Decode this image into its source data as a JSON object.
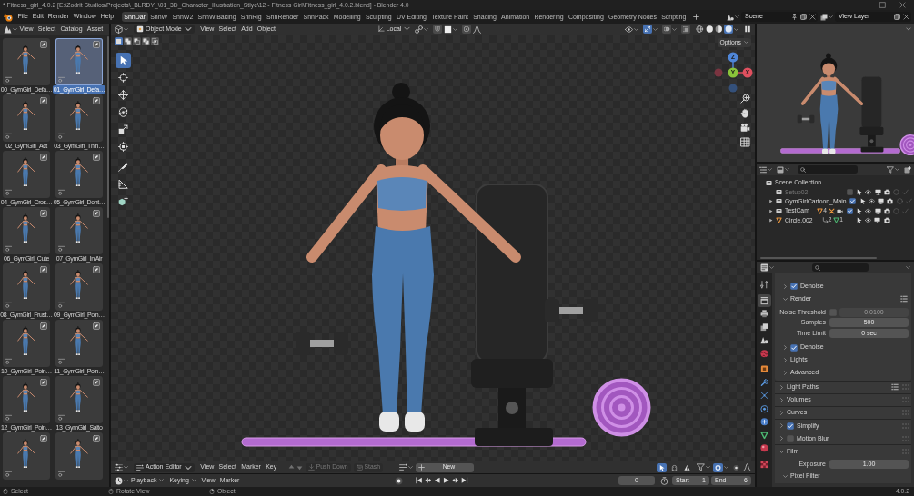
{
  "window": {
    "title": "* Fitness_girl_4.0.2 [E:\\Zodrit Studios\\Projects\\_BLRDY_\\01_3D_Character_Illustration_Stlye\\12 - Fitness Girl\\Fitness_girl_4.0.2.blend] - Blender 4.0"
  },
  "menu_bar": {
    "menus": [
      "File",
      "Edit",
      "Render",
      "Window",
      "Help"
    ],
    "workspaces": [
      {
        "label": "ShnDar",
        "selected": true
      },
      {
        "label": "ShnW",
        "selected": false
      },
      {
        "label": "ShnW2",
        "selected": false
      },
      {
        "label": "ShnW.Baking",
        "selected": false
      },
      {
        "label": "ShnRig",
        "selected": false
      },
      {
        "label": "ShnRender",
        "selected": false
      },
      {
        "label": "ShnPack",
        "selected": false
      },
      {
        "label": "Modelling",
        "selected": false
      },
      {
        "label": "Sculpting",
        "selected": false
      },
      {
        "label": "UV Editing",
        "selected": false
      },
      {
        "label": "Texture Paint",
        "selected": false
      },
      {
        "label": "Shading",
        "selected": false
      },
      {
        "label": "Animation",
        "selected": false
      },
      {
        "label": "Rendering",
        "selected": false
      },
      {
        "label": "Compositing",
        "selected": false
      },
      {
        "label": "Geometry Nodes",
        "selected": false
      },
      {
        "label": "Scripting",
        "selected": false
      }
    ],
    "scene": "Scene",
    "view_layer": "View Layer"
  },
  "asset_browser": {
    "menus": [
      "View",
      "Select",
      "Catalog",
      "Asset"
    ],
    "assets": [
      {
        "label": "00_GymGirl_Defa…",
        "selected": false
      },
      {
        "label": "01_GymGirl_Defa…",
        "selected": true
      },
      {
        "label": "02_GymGirl_Act",
        "selected": false
      },
      {
        "label": "03_GymGirl_Thin…",
        "selected": false
      },
      {
        "label": "04_GymGirl_Cros…",
        "selected": false
      },
      {
        "label": "05_GymGirl_Dont…",
        "selected": false
      },
      {
        "label": "06_GymGirl_Cute",
        "selected": false
      },
      {
        "label": "07_GymGirl_In Air",
        "selected": false
      },
      {
        "label": "08_GymGirl_Frust…",
        "selected": false
      },
      {
        "label": "09_GymGirl_Poin…",
        "selected": false
      },
      {
        "label": "10_GymGirl_Poin…",
        "selected": false
      },
      {
        "label": "11_GymGirl_Poin…",
        "selected": false
      },
      {
        "label": "12_GymGirl_Poin…",
        "selected": false
      },
      {
        "label": "13_GymGirl_Salto",
        "selected": false
      },
      {
        "selected": false
      },
      {
        "selected": false
      }
    ]
  },
  "viewport": {
    "mode": "Object Mode",
    "menus": [
      "View",
      "Select",
      "Add",
      "Object"
    ],
    "orientation": "Local",
    "toggles": [
      {
        "kind": "snap",
        "on": false
      },
      {
        "kind": "proportional",
        "on": false
      },
      {
        "kind": "gizmos",
        "on": true
      },
      {
        "kind": "overlays",
        "on": false
      },
      {
        "kind": "xray",
        "on": false
      }
    ],
    "shading": [
      {
        "kind": "wireframe",
        "selected": false
      },
      {
        "kind": "solid",
        "selected": false
      },
      {
        "kind": "material",
        "selected": false
      },
      {
        "kind": "rendered",
        "selected": true
      }
    ],
    "select_modes": [
      {
        "kind": "set",
        "selected": true
      },
      {
        "kind": "extend",
        "selected": false
      },
      {
        "kind": "subtract",
        "selected": false
      },
      {
        "kind": "difference",
        "selected": false
      },
      {
        "kind": "intersect",
        "selected": false
      }
    ],
    "options": "Options",
    "tools": [
      {
        "kind": "select_box",
        "selected": true
      },
      {
        "kind": "cursor",
        "selected": false
      },
      {
        "kind": "move",
        "selected": false
      },
      {
        "kind": "rotate",
        "selected": false
      },
      {
        "kind": "scale",
        "selected": false
      },
      {
        "kind": "transform",
        "selected": false
      },
      {
        "kind": "annotate",
        "selected": false
      },
      {
        "kind": "measure",
        "selected": false
      },
      {
        "kind": "add_cube",
        "selected": false
      }
    ],
    "gizmo_axes": [
      "Z",
      "Y",
      "X"
    ]
  },
  "outliner": {
    "root": "Scene Collection",
    "items": [
      {
        "kind": "collection",
        "label": "Setup02",
        "checked": false
      },
      {
        "kind": "collection",
        "label": "GymGirlCartoon_Main",
        "expanded": false,
        "checked": true
      },
      {
        "kind": "collection",
        "label": "TestCam",
        "expanded": false,
        "checked": true,
        "contents": [
          {
            "kind": "mesh",
            "count": "4"
          },
          {
            "kind": "armature"
          },
          {
            "kind": "camera"
          }
        ]
      },
      {
        "kind": "object",
        "label": "Circle.002",
        "expanded": false,
        "contents": [
          {
            "kind": "child",
            "count": "2"
          },
          {
            "kind": "mesh_data",
            "count": "1"
          }
        ]
      }
    ]
  },
  "properties": {
    "tabs": [
      {
        "kind": "tool",
        "selected": false
      },
      {
        "kind": "render",
        "selected": true
      },
      {
        "kind": "output",
        "selected": false
      },
      {
        "kind": "view_layer",
        "selected": false
      },
      {
        "kind": "scene",
        "selected": false
      },
      {
        "kind": "world",
        "selected": false
      },
      {
        "kind": "object",
        "selected": false
      },
      {
        "kind": "modifiers",
        "selected": false
      },
      {
        "kind": "particles",
        "selected": false
      },
      {
        "kind": "physics",
        "selected": false
      },
      {
        "kind": "constraints",
        "selected": false
      },
      {
        "kind": "data",
        "selected": false
      },
      {
        "kind": "material",
        "selected": false
      },
      {
        "kind": "texture",
        "selected": false
      }
    ],
    "subpanels": [
      {
        "label": "Denoise",
        "checked": true,
        "expanded": false,
        "presets": false
      },
      {
        "label": "Render",
        "expanded": true,
        "presets": true,
        "fields": [
          {
            "label": "Noise Threshold",
            "checked": false,
            "value": "0.0100"
          },
          {
            "label": "Samples",
            "value": "500"
          },
          {
            "label": "Time Limit",
            "value": "0 sec"
          }
        ]
      },
      {
        "label": "Denoise",
        "checked": true,
        "expanded": false,
        "presets": false
      },
      {
        "label": "Lights",
        "expanded": false,
        "presets": false
      },
      {
        "label": "Advanced",
        "expanded": false,
        "presets": false
      }
    ],
    "panels": [
      {
        "label": "Light Paths",
        "expanded": false,
        "presets": true
      },
      {
        "label": "Volumes",
        "expanded": false,
        "presets": false
      },
      {
        "label": "Curves",
        "expanded": false,
        "presets": false
      },
      {
        "label": "Simplify",
        "checked": true,
        "expanded": false,
        "presets": false
      },
      {
        "label": "Motion Blur",
        "checked": false,
        "expanded": false,
        "presets": false
      },
      {
        "label": "Film",
        "expanded": true,
        "presets": false,
        "fields": [
          {
            "label": "Exposure",
            "value": "1.00"
          }
        ],
        "subpanels": [
          {
            "label": "Pixel Filter",
            "expanded": true,
            "presets": false
          }
        ]
      }
    ]
  },
  "action_editor": {
    "mode": "Action Editor",
    "menus": [
      "View",
      "Select",
      "Marker",
      "Key"
    ],
    "buttons": [
      {
        "kind": "push_down",
        "label": "Push Down",
        "disabled": true
      },
      {
        "kind": "stash",
        "label": "Stash",
        "disabled": true
      }
    ],
    "new": "New",
    "toggles": [
      {
        "kind": "only_selected",
        "on": true
      },
      {
        "kind": "show_hidden",
        "on": false
      },
      {
        "kind": "only_errors",
        "on": false
      },
      {
        "kind": "snap",
        "on": true
      },
      {
        "kind": "proportional",
        "on": false
      }
    ]
  },
  "timeline": {
    "menus": [
      {
        "kind": "dropdown",
        "label": "Playback"
      },
      {
        "kind": "dropdown",
        "label": "Keying"
      },
      {
        "kind": "menu",
        "label": "View"
      },
      {
        "kind": "menu",
        "label": "Marker"
      }
    ],
    "frame": "0",
    "start": {
      "label": "Start",
      "value": "1"
    },
    "end": {
      "label": "End",
      "value": "6"
    }
  },
  "status_bar": {
    "hints": [
      {
        "kind": "left_click",
        "label": "Select"
      },
      {
        "kind": "middle_click",
        "label": "Rotate View"
      },
      {
        "kind": "right_click",
        "label": "Object"
      }
    ],
    "version": "4.0.2"
  }
}
